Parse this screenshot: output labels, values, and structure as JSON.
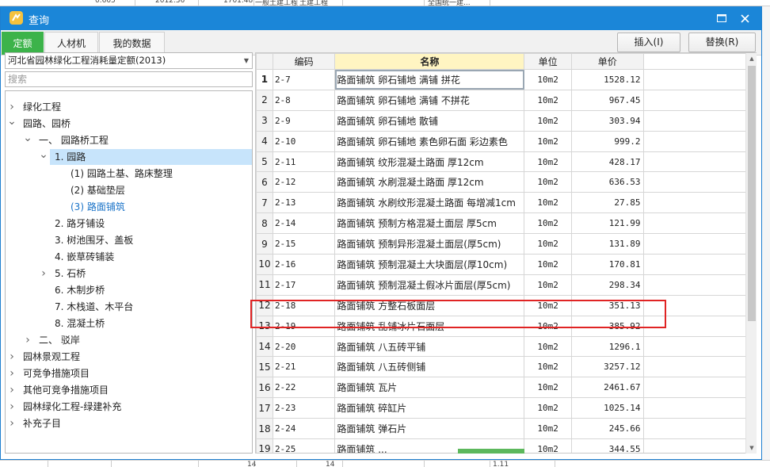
{
  "background": {
    "top_fragments": [
      "0.605",
      "2012.36",
      "1701.48",
      "一般土建工程",
      "土建工程",
      "全国统一建..."
    ],
    "bottom_fragments": [
      "14",
      "14",
      "1.11"
    ]
  },
  "dialog": {
    "title": "查询",
    "max_icon": "maximize-icon",
    "close_icon": "close-icon"
  },
  "tabs": [
    {
      "label": "定额",
      "active": true
    },
    {
      "label": "人材机",
      "active": false
    },
    {
      "label": "我的数据",
      "active": false
    }
  ],
  "toolbar": {
    "insert_label": "插入(I)",
    "replace_label": "替换(R)"
  },
  "left": {
    "library": "河北省园林绿化工程消耗量定额(2013)",
    "search_placeholder": "搜索",
    "tree": [
      {
        "label": "绿化工程",
        "level": 0,
        "arrow": "right"
      },
      {
        "label": "园路、园桥",
        "level": 0,
        "arrow": "down"
      },
      {
        "label": "一、 园路桥工程",
        "level": 1,
        "arrow": "down"
      },
      {
        "label": "1. 园路",
        "level": 2,
        "arrow": "down",
        "selected": true
      },
      {
        "label": "(1) 园路土基、路床整理",
        "level": 3
      },
      {
        "label": "(2) 基础垫层",
        "level": 3
      },
      {
        "label": "(3) 路面铺筑",
        "level": 3,
        "active": true
      },
      {
        "label": "2. 路牙铺设",
        "level": 2
      },
      {
        "label": "3. 树池围牙、盖板",
        "level": 2
      },
      {
        "label": "4. 嵌草砖铺装",
        "level": 2
      },
      {
        "label": "5. 石桥",
        "level": 2,
        "arrow": "right"
      },
      {
        "label": "6. 木制步桥",
        "level": 2
      },
      {
        "label": "7. 木栈道、木平台",
        "level": 2
      },
      {
        "label": "8. 混凝土桥",
        "level": 2
      },
      {
        "label": "二、 驳岸",
        "level": 1,
        "arrow": "right"
      },
      {
        "label": "园林景观工程",
        "level": 0,
        "arrow": "right"
      },
      {
        "label": "可竞争措施项目",
        "level": 0,
        "arrow": "right"
      },
      {
        "label": "其他可竞争措施项目",
        "level": 0,
        "arrow": "right"
      },
      {
        "label": "园林绿化工程-绿建补充",
        "level": 0,
        "arrow": "right"
      },
      {
        "label": "补充子目",
        "level": 0,
        "arrow": "right"
      }
    ]
  },
  "grid": {
    "headers": {
      "code": "编码",
      "name": "名称",
      "unit": "单位",
      "price": "单价"
    },
    "rows": [
      {
        "n": "1",
        "code": "2-7",
        "name": "路面铺筑 卵石铺地 满铺 拼花",
        "unit": "10m2",
        "price": "1528.12"
      },
      {
        "n": "2",
        "code": "2-8",
        "name": "路面铺筑 卵石铺地 满铺 不拼花",
        "unit": "10m2",
        "price": "967.45"
      },
      {
        "n": "3",
        "code": "2-9",
        "name": "路面铺筑 卵石铺地 散铺",
        "unit": "10m2",
        "price": "303.94"
      },
      {
        "n": "4",
        "code": "2-10",
        "name": "路面铺筑 卵石铺地 素色卵石面 彩边素色",
        "unit": "10m2",
        "price": "999.2"
      },
      {
        "n": "5",
        "code": "2-11",
        "name": "路面铺筑 纹形混凝土路面 厚12cm",
        "unit": "10m2",
        "price": "428.17"
      },
      {
        "n": "6",
        "code": "2-12",
        "name": "路面铺筑 水刷混凝土路面 厚12cm",
        "unit": "10m2",
        "price": "636.53"
      },
      {
        "n": "7",
        "code": "2-13",
        "name": "路面铺筑 水刷纹形混凝土路面 每增减1cm",
        "unit": "10m2",
        "price": "27.85"
      },
      {
        "n": "8",
        "code": "2-14",
        "name": "路面铺筑 预制方格混凝土面层 厚5cm",
        "unit": "10m2",
        "price": "121.99"
      },
      {
        "n": "9",
        "code": "2-15",
        "name": "路面铺筑 预制异形混凝土面层(厚5cm)",
        "unit": "10m2",
        "price": "131.89"
      },
      {
        "n": "10",
        "code": "2-16",
        "name": "路面铺筑 预制混凝土大块面层(厚10cm)",
        "unit": "10m2",
        "price": "170.81"
      },
      {
        "n": "11",
        "code": "2-17",
        "name": "路面铺筑 预制混凝土假冰片面层(厚5cm)",
        "unit": "10m2",
        "price": "298.34"
      },
      {
        "n": "12",
        "code": "2-18",
        "name": "路面铺筑 方整石板面层",
        "unit": "10m2",
        "price": "351.13"
      },
      {
        "n": "13",
        "code": "2-19",
        "name": "路面铺筑 乱铺冰片石面层",
        "unit": "10m2",
        "price": "385.92"
      },
      {
        "n": "14",
        "code": "2-20",
        "name": "路面铺筑 八五砖平铺",
        "unit": "10m2",
        "price": "1296.1"
      },
      {
        "n": "15",
        "code": "2-21",
        "name": "路面铺筑 八五砖侧铺",
        "unit": "10m2",
        "price": "3257.12"
      },
      {
        "n": "16",
        "code": "2-22",
        "name": "路面铺筑 瓦片",
        "unit": "10m2",
        "price": "2461.67"
      },
      {
        "n": "17",
        "code": "2-23",
        "name": "路面铺筑 碎缸片",
        "unit": "10m2",
        "price": "1025.14"
      },
      {
        "n": "18",
        "code": "2-24",
        "name": "路面铺筑 弹石片",
        "unit": "10m2",
        "price": "245.66"
      },
      {
        "n": "19",
        "code": "2-25",
        "name": "路面铺筑 ...",
        "unit": "10m2",
        "price": "344.55"
      }
    ]
  },
  "colors": {
    "titlebar": "#1b86d8",
    "active_tab": "#3cb34a",
    "highlight": "#e02424",
    "name_header": "#fff5c2",
    "tree_selected": "#c7e4fb"
  }
}
